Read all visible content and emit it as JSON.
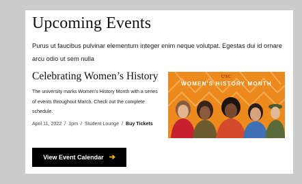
{
  "section": {
    "heading": "Upcoming Events",
    "intro": "Purus ut faucibus pulvinar elementum integer enim neque volutpat. Egestas dui id ornare arcu odio ut sem nulla"
  },
  "event": {
    "title": "Celebrating Women’s History",
    "description": "The university marks Women's History Month with a series of events throughout March. Check out the complete schedule.",
    "date": "April 11, 2022",
    "time": "1pm",
    "location": "Student Lounge",
    "tickets_label": "Buy Tickets",
    "separator": "/"
  },
  "banner": {
    "logo_text": "USC",
    "headline": "WOMEN'S HISTORY MONTH",
    "background_color": "#ec8a1e"
  },
  "calendar_button": {
    "label": "View Event Calendar",
    "icon": "arrow-right-icon",
    "arrow_color": "#f5b800"
  }
}
